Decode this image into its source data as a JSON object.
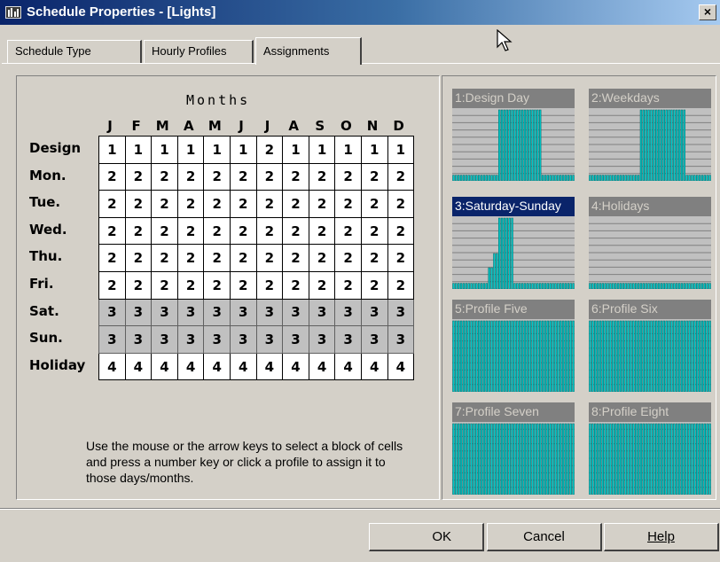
{
  "window": {
    "title": "Schedule Properties - [Lights]",
    "close_label": "×"
  },
  "tabs": [
    {
      "label": "Schedule Type",
      "mnemonic": "S"
    },
    {
      "label": "Hourly Profiles",
      "mnemonic": "H"
    },
    {
      "label": "Assignments",
      "mnemonic": "A",
      "active": true
    }
  ],
  "grid": {
    "heading": "Months",
    "months": [
      "J",
      "F",
      "M",
      "A",
      "M",
      "J",
      "J",
      "A",
      "S",
      "O",
      "N",
      "D"
    ],
    "rows": [
      {
        "label": "Design",
        "values": [
          "1",
          "1",
          "1",
          "1",
          "1",
          "1",
          "2",
          "1",
          "1",
          "1",
          "1",
          "1"
        ]
      },
      {
        "label": "Mon.",
        "values": [
          "2",
          "2",
          "2",
          "2",
          "2",
          "2",
          "2",
          "2",
          "2",
          "2",
          "2",
          "2"
        ]
      },
      {
        "label": "Tue.",
        "values": [
          "2",
          "2",
          "2",
          "2",
          "2",
          "2",
          "2",
          "2",
          "2",
          "2",
          "2",
          "2"
        ]
      },
      {
        "label": "Wed.",
        "values": [
          "2",
          "2",
          "2",
          "2",
          "2",
          "2",
          "2",
          "2",
          "2",
          "2",
          "2",
          "2"
        ]
      },
      {
        "label": "Thu.",
        "values": [
          "2",
          "2",
          "2",
          "2",
          "2",
          "2",
          "2",
          "2",
          "2",
          "2",
          "2",
          "2"
        ]
      },
      {
        "label": "Fri.",
        "values": [
          "2",
          "2",
          "2",
          "2",
          "2",
          "2",
          "2",
          "2",
          "2",
          "2",
          "2",
          "2"
        ]
      },
      {
        "label": "Sat.",
        "values": [
          "3",
          "3",
          "3",
          "3",
          "3",
          "3",
          "3",
          "3",
          "3",
          "3",
          "3",
          "3"
        ],
        "selected": true
      },
      {
        "label": "Sun.",
        "values": [
          "3",
          "3",
          "3",
          "3",
          "3",
          "3",
          "3",
          "3",
          "3",
          "3",
          "3",
          "3"
        ],
        "selected": true
      },
      {
        "label": "Holiday",
        "values": [
          "4",
          "4",
          "4",
          "4",
          "4",
          "4",
          "4",
          "4",
          "4",
          "4",
          "4",
          "4"
        ]
      }
    ],
    "instructions": "Use the mouse or the arrow keys to select a block of cells and press a number key or click a profile to assign it to those days/months."
  },
  "profiles": [
    {
      "label": "1:Design Day",
      "hourly": [
        0.08,
        0.08,
        0.08,
        0.08,
        0.08,
        0.08,
        0.08,
        0.08,
        0.08,
        0.08,
        0.08,
        0.08,
        0.08,
        0.08,
        0.08,
        0.08,
        0.08,
        0.08,
        1,
        1,
        1,
        1,
        1,
        1,
        1,
        1,
        1,
        1,
        1,
        1,
        1,
        1,
        1,
        1,
        1,
        0.08,
        0.08,
        0.08,
        0.08,
        0.08,
        0.08,
        0.08,
        0.08,
        0.08,
        0.08,
        0.08,
        0.08,
        0.08
      ]
    },
    {
      "label": "2:Weekdays",
      "hourly": [
        0.08,
        0.08,
        0.08,
        0.08,
        0.08,
        0.08,
        0.08,
        0.08,
        0.08,
        0.08,
        0.08,
        0.08,
        0.08,
        0.08,
        0.08,
        0.08,
        0.08,
        0.08,
        0.08,
        0.08,
        1,
        1,
        1,
        1,
        1,
        1,
        1,
        1,
        1,
        1,
        1,
        1,
        1,
        1,
        1,
        1,
        1,
        1,
        0.08,
        0.08,
        0.08,
        0.08,
        0.08,
        0.08,
        0.08,
        0.08,
        0.08,
        0.08
      ]
    },
    {
      "label": "3:Saturday-Sunday",
      "selected": true,
      "hourly": [
        0.08,
        0.08,
        0.08,
        0.08,
        0.08,
        0.08,
        0.08,
        0.08,
        0.08,
        0.08,
        0.08,
        0.08,
        0.08,
        0.08,
        0.3,
        0.3,
        0.5,
        0.5,
        1,
        1,
        1,
        1,
        1,
        1,
        0.08,
        0.08,
        0.08,
        0.08,
        0.08,
        0.08,
        0.08,
        0.08,
        0.08,
        0.08,
        0.08,
        0.08,
        0.08,
        0.08,
        0.08,
        0.08,
        0.08,
        0.08,
        0.08,
        0.08,
        0.08,
        0.08,
        0.08,
        0.08
      ]
    },
    {
      "label": "4:Holidays",
      "hourly": [
        0.08,
        0.08,
        0.08,
        0.08,
        0.08,
        0.08,
        0.08,
        0.08,
        0.08,
        0.08,
        0.08,
        0.08,
        0.08,
        0.08,
        0.08,
        0.08,
        0.08,
        0.08,
        0.08,
        0.08,
        0.08,
        0.08,
        0.08,
        0.08,
        0.08,
        0.08,
        0.08,
        0.08,
        0.08,
        0.08,
        0.08,
        0.08,
        0.08,
        0.08,
        0.08,
        0.08,
        0.08,
        0.08,
        0.08,
        0.08,
        0.08,
        0.08,
        0.08,
        0.08,
        0.08,
        0.08,
        0.08,
        0.08
      ]
    },
    {
      "label": "5:Profile Five",
      "hourly": [
        1,
        1,
        1,
        1,
        1,
        1,
        1,
        1,
        1,
        1,
        1,
        1,
        1,
        1,
        1,
        1,
        1,
        1,
        1,
        1,
        1,
        1,
        1,
        1,
        1,
        1,
        1,
        1,
        1,
        1,
        1,
        1,
        1,
        1,
        1,
        1,
        1,
        1,
        1,
        1,
        1,
        1,
        1,
        1,
        1,
        1,
        1,
        1
      ]
    },
    {
      "label": "6:Profile Six",
      "hourly": [
        1,
        1,
        1,
        1,
        1,
        1,
        1,
        1,
        1,
        1,
        1,
        1,
        1,
        1,
        1,
        1,
        1,
        1,
        1,
        1,
        1,
        1,
        1,
        1,
        1,
        1,
        1,
        1,
        1,
        1,
        1,
        1,
        1,
        1,
        1,
        1,
        1,
        1,
        1,
        1,
        1,
        1,
        1,
        1,
        1,
        1,
        1,
        1
      ]
    },
    {
      "label": "7:Profile Seven",
      "hourly": [
        1,
        1,
        1,
        1,
        1,
        1,
        1,
        1,
        1,
        1,
        1,
        1,
        1,
        1,
        1,
        1,
        1,
        1,
        1,
        1,
        1,
        1,
        1,
        1,
        1,
        1,
        1,
        1,
        1,
        1,
        1,
        1,
        1,
        1,
        1,
        1,
        1,
        1,
        1,
        1,
        1,
        1,
        1,
        1,
        1,
        1,
        1,
        1
      ]
    },
    {
      "label": "8:Profile Eight",
      "hourly": [
        1,
        1,
        1,
        1,
        1,
        1,
        1,
        1,
        1,
        1,
        1,
        1,
        1,
        1,
        1,
        1,
        1,
        1,
        1,
        1,
        1,
        1,
        1,
        1,
        1,
        1,
        1,
        1,
        1,
        1,
        1,
        1,
        1,
        1,
        1,
        1,
        1,
        1,
        1,
        1,
        1,
        1,
        1,
        1,
        1,
        1,
        1,
        1
      ]
    }
  ],
  "buttons": {
    "ok": "OK",
    "cancel": "Cancel",
    "help": "Help"
  },
  "colors": {
    "bar": "#00c8c8",
    "profile_bg": "#c0c0c0",
    "grid_line": "#808080"
  }
}
